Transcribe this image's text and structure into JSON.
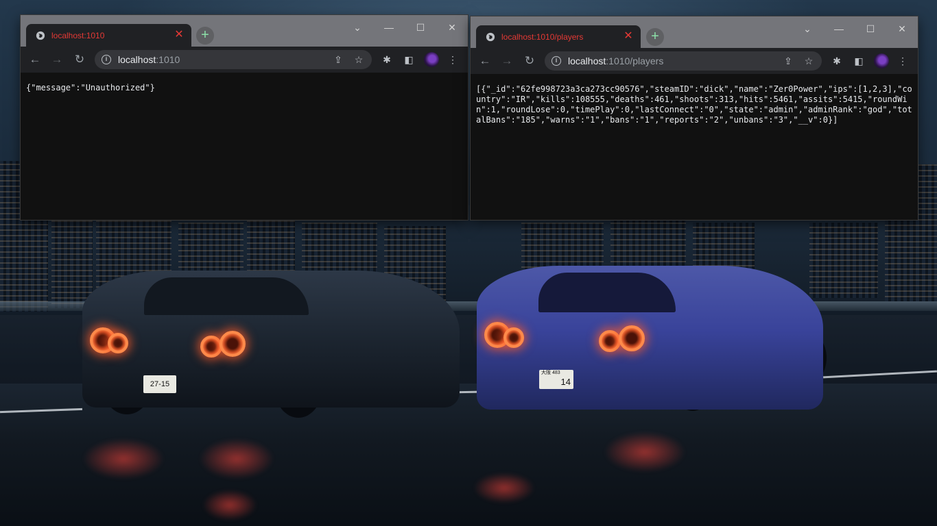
{
  "window_left": {
    "tab_title": "localhost:1010",
    "url_host": "localhost",
    "url_rest": ":1010",
    "body_text": "{\"message\":\"Unauthorized\"}"
  },
  "window_right": {
    "tab_title": "localhost:1010/players",
    "url_host": "localhost",
    "url_rest": ":1010/players",
    "body_text": "[{\"_id\":\"62fe998723a3ca273cc90576\",\"steamID\":\"dick\",\"name\":\"Zer0Power\",\"ips\":[1,2,3],\"country\":\"IR\",\"kills\":108555,\"deaths\":461,\"shoots\":313,\"hits\":5461,\"assits\":5415,\"roundWin\":1,\"roundLose\":0,\"timePlay\":0,\"lastConnect\":\"0\",\"state\":\"admin\",\"adminRank\":\"god\",\"totalBans\":\"185\",\"warns\":\"1\",\"bans\":\"1\",\"reports\":\"2\",\"unbans\":\"3\",\"__v\":0}]"
  },
  "wallpaper": {
    "plate_left_text": "27-15",
    "plate_right_text": "14",
    "plate_right_prefix": "大阪 483"
  },
  "colors": {
    "tab_title": "#e53935",
    "titlebar": "#74757a",
    "toolbar": "#202124",
    "page_bg": "#111111"
  },
  "icons": {
    "favicon": "globe-icon",
    "new_tab": "plus-icon",
    "back": "arrow-left-icon",
    "forward": "arrow-right-icon",
    "reload": "reload-icon",
    "site_info": "info-icon",
    "share": "share-icon",
    "bookmark": "star-icon",
    "extensions": "puzzle-icon",
    "side_panel": "side-panel-icon",
    "menu": "kebab-menu-icon"
  }
}
